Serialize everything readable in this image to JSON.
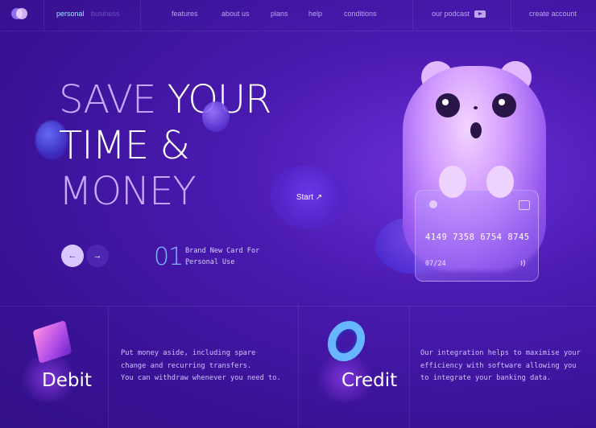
{
  "nav": {
    "personal": "personal",
    "business": "business",
    "features": "features",
    "about_us": "about us",
    "plans": "plans",
    "help": "help",
    "conditions": "conditions",
    "podcast": "our podcast",
    "create_account": "create account"
  },
  "hero": {
    "title_save": "SAVE",
    "title_your": "YOUR",
    "title_time": "TIME &",
    "title_money": "MONEY",
    "start_label": "Start ↗",
    "prev_arrow": "←",
    "next_arrow": "→",
    "step_number": "01",
    "step_dot": ".",
    "step_line1": "Brand New Card For",
    "step_line2": "Personal Use"
  },
  "card": {
    "number": "4149 7358 6754 8745",
    "expiry": "07/24",
    "nfc_symbol": "))))"
  },
  "features": [
    {
      "title": "Debit",
      "desc_lines": [
        "Put money aside, including spare",
        "change and recurring transfers.",
        "You can withdraw whenever you need to."
      ]
    },
    {
      "title": "Credit",
      "desc_lines": [
        "Our integration helps to maximise your",
        "efficiency with software allowing you",
        "to integrate your banking data."
      ]
    }
  ],
  "colors": {
    "background": "#3a1296",
    "accent_blue": "#7fb6ff",
    "accent_lilac": "#c9a8ff"
  }
}
